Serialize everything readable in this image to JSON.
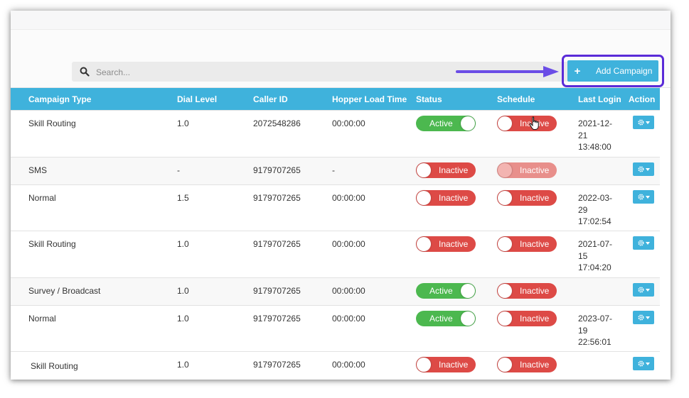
{
  "search": {
    "placeholder": "Search..."
  },
  "toolbar": {
    "add_label": "Add Campaign"
  },
  "colors": {
    "accent": "#3fb2dc",
    "active": "#4cb84f",
    "inactive": "#dd4a46",
    "highlight": "#5a2bd8"
  },
  "table": {
    "headers": [
      "Campaign Type",
      "Dial Level",
      "Caller ID",
      "Hopper Load Time",
      "Status",
      "Schedule",
      "Last Login",
      "Action"
    ],
    "rows": [
      {
        "type": "Skill Routing",
        "dial": "1.0",
        "caller": "2072548286",
        "hopper": "00:00:00",
        "status": "Active",
        "schedule": "Inactive",
        "last_login": [
          "2021-12-",
          "21",
          "13:48:00"
        ]
      },
      {
        "type": "SMS",
        "dial": "-",
        "caller": "9179707265",
        "hopper": "-",
        "status": "Inactive",
        "schedule": "Inactive",
        "last_login": [
          "",
          "",
          ""
        ]
      },
      {
        "type": "Normal",
        "dial": "1.5",
        "caller": "9179707265",
        "hopper": "00:00:00",
        "status": "Inactive",
        "schedule": "Inactive",
        "last_login": [
          "2022-03-",
          "29",
          "17:02:54"
        ]
      },
      {
        "type": "Skill Routing",
        "dial": "1.0",
        "caller": "9179707265",
        "hopper": "00:00:00",
        "status": "Inactive",
        "schedule": "Inactive",
        "last_login": [
          "2021-07-",
          "15",
          "17:04:20"
        ]
      },
      {
        "type": "Survey / Broadcast",
        "dial": "1.0",
        "caller": "9179707265",
        "hopper": "00:00:00",
        "status": "Active",
        "schedule": "Inactive",
        "last_login": [
          "",
          "",
          ""
        ]
      },
      {
        "type": "Normal",
        "dial": "1.0",
        "caller": "9179707265",
        "hopper": "00:00:00",
        "status": "Active",
        "schedule": "Inactive",
        "last_login": [
          "2023-07-",
          "19",
          "22:56:01"
        ]
      },
      {
        "type": "Skill Routing",
        "dial": "1.0",
        "caller": "9179707265",
        "hopper": "00:00:00",
        "status": "Inactive",
        "schedule": "Inactive",
        "last_login": [
          "",
          "",
          ""
        ]
      }
    ]
  }
}
